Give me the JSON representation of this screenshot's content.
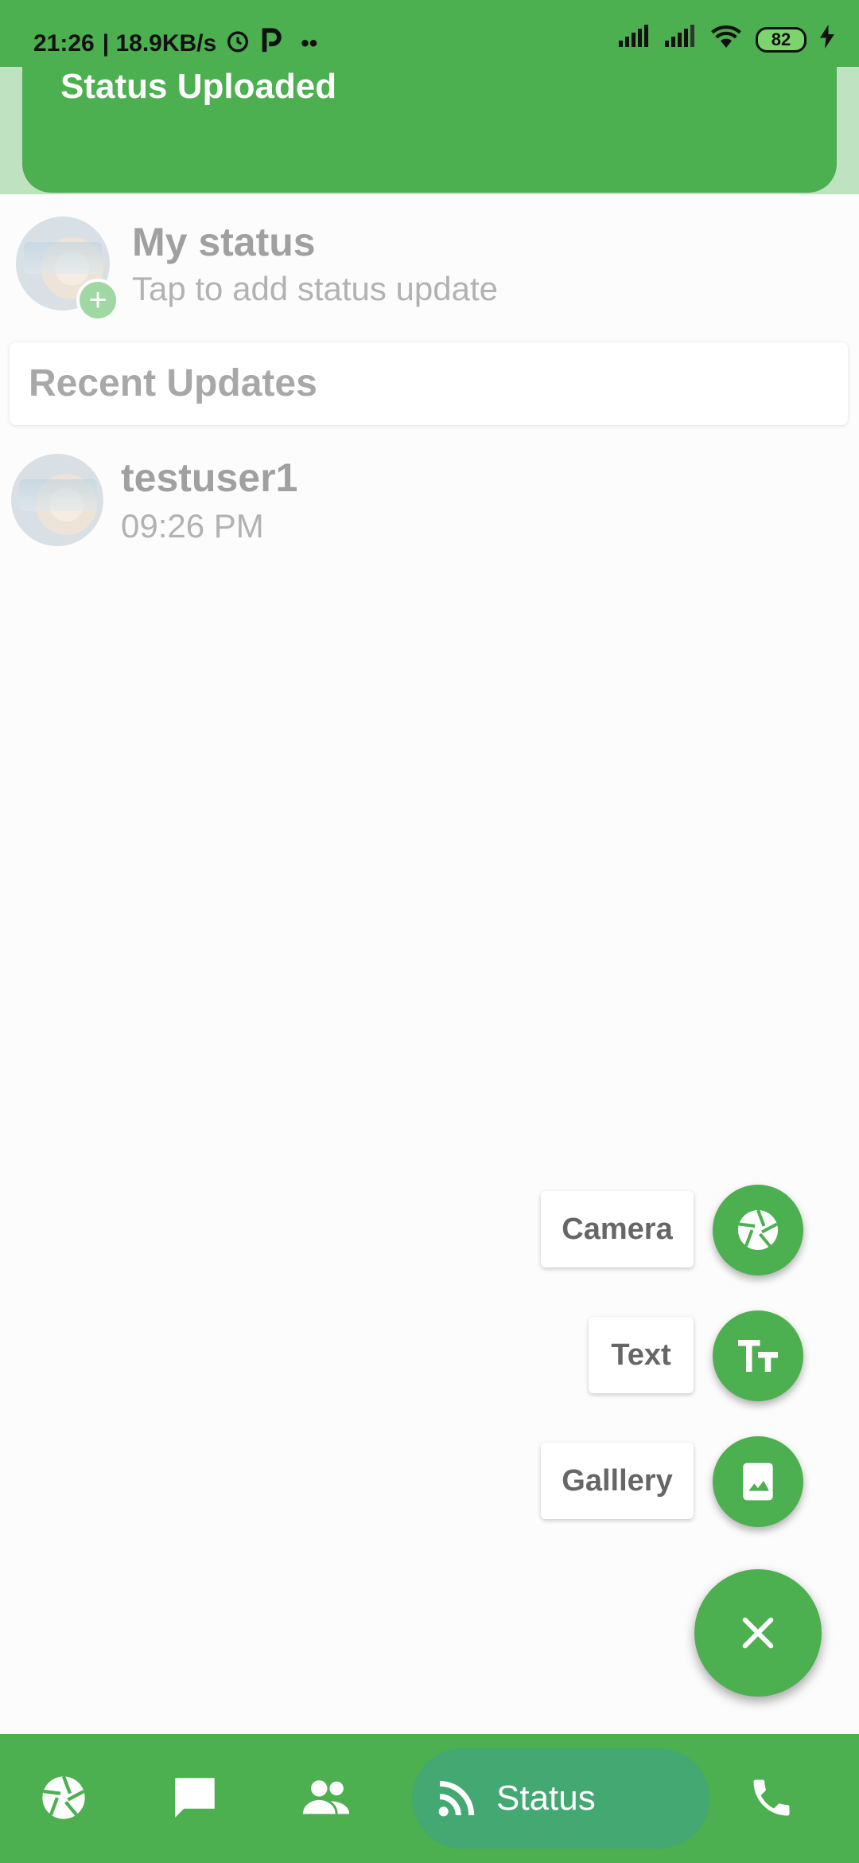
{
  "status_bar": {
    "time": "21:26",
    "net_speed": "| 18.9KB/s",
    "dots": "••",
    "battery": "82"
  },
  "snackbar": {
    "message": "Status Uploaded"
  },
  "my_status": {
    "title": "My status",
    "subtitle": "Tap to add status update"
  },
  "recent": {
    "title": "Recent Updates"
  },
  "updates": [
    {
      "name": "testuser1",
      "time": "09:26 PM"
    }
  ],
  "speed_dial": {
    "camera_label": "Camera",
    "text_label": "Text",
    "gallery_label": "Galllery"
  },
  "bottom_nav": {
    "active_label": "Status",
    "items": [
      "camera-icon",
      "chat-icon",
      "people-icon",
      "rss-icon",
      "phone-icon"
    ]
  },
  "colors": {
    "primary": "#4caf50",
    "active_pill": "#43a872"
  }
}
